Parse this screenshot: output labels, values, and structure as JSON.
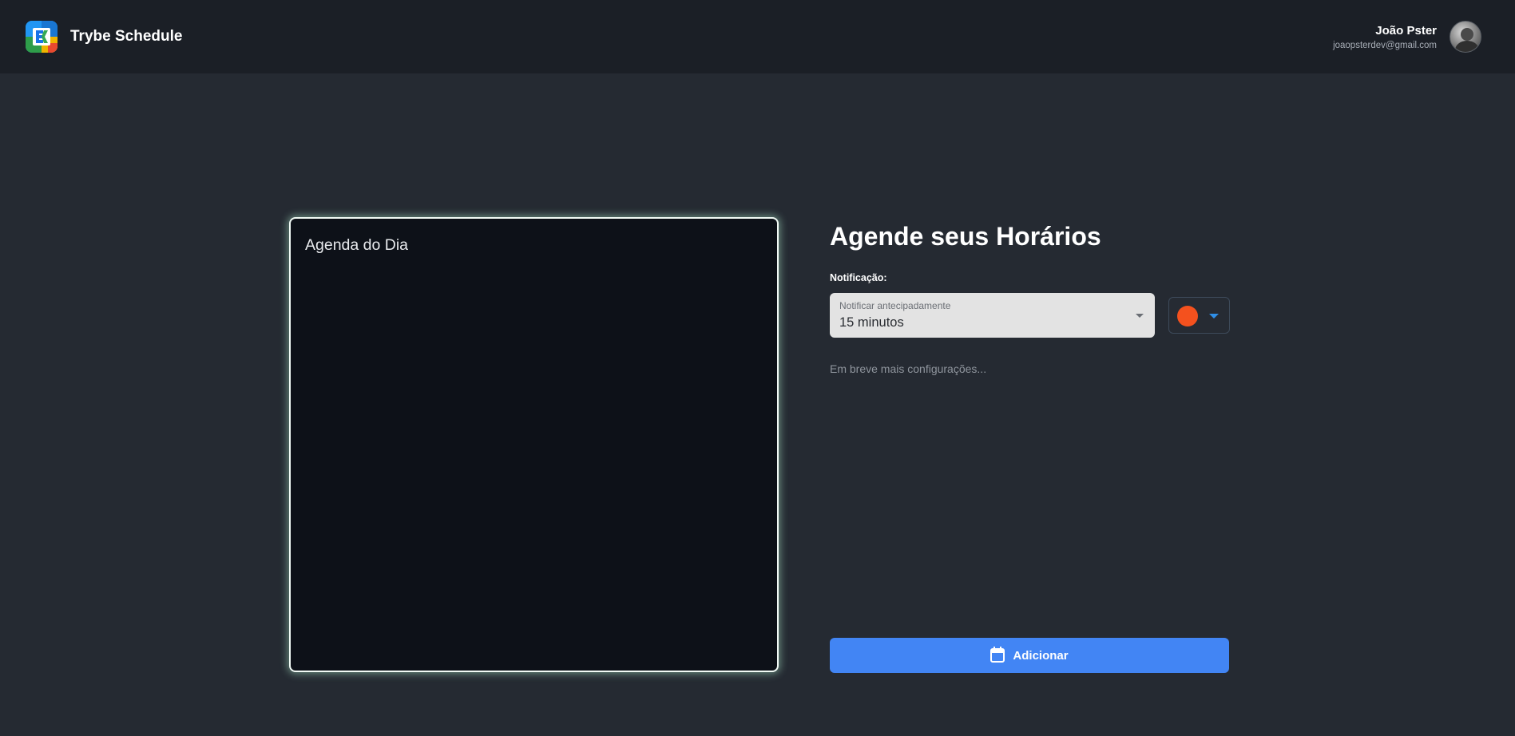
{
  "header": {
    "app_name": "Trybe Schedule",
    "user_name": "João Pster",
    "user_email": "joaopsterdev@gmail.com"
  },
  "agenda": {
    "title": "Agenda do Dia"
  },
  "panel": {
    "title": "Agende seus Horários",
    "notification_label": "Notificação:",
    "notify_select": {
      "label": "Notificar antecipadamente",
      "value": "15 minutos"
    },
    "color_picker": {
      "selected_color": "#f4511e"
    },
    "hint": "Em breve mais configurações...",
    "add_button_label": "Adicionar"
  },
  "icons": {
    "logo": "calendar-logo-icon",
    "avatar": "user-avatar",
    "select_arrow": "chevron-down-icon",
    "color_arrow": "chevron-down-icon",
    "add_button": "calendar-icon"
  },
  "colors": {
    "background": "#252a32",
    "header": "#1b1f26",
    "agenda_bg": "#0d1118",
    "accent": "#4285f4"
  }
}
